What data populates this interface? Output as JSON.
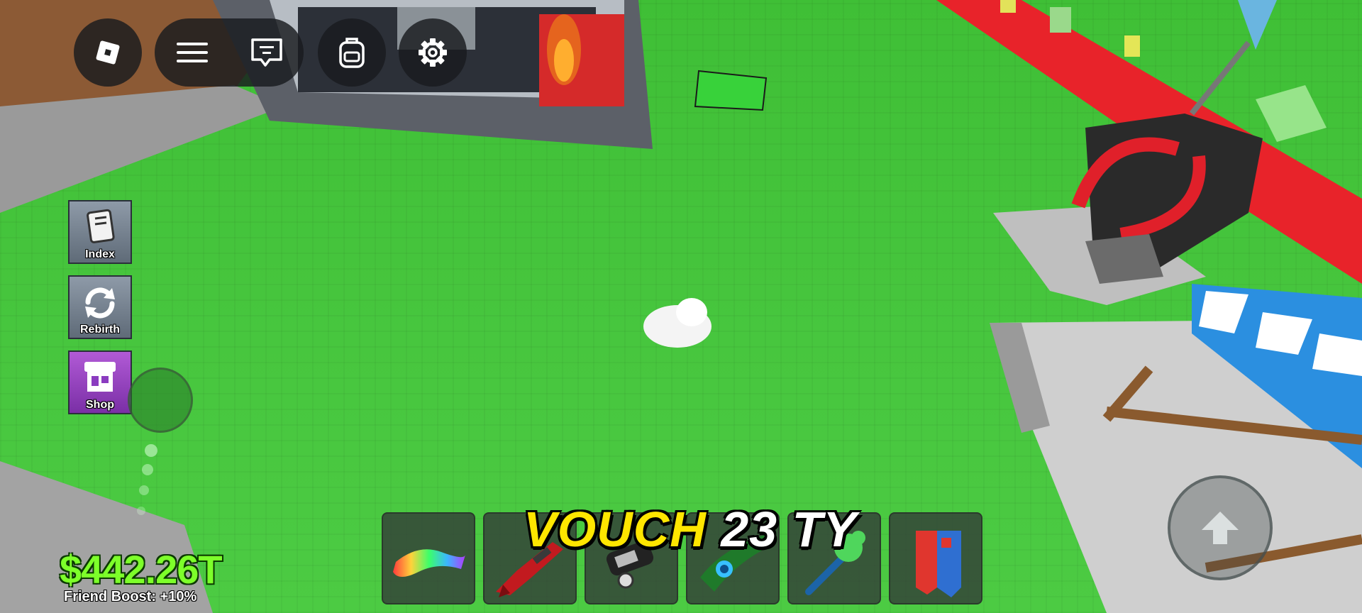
{
  "topbar": {
    "roblox_icon": "roblox-logo-icon",
    "menu_icon": "hamburger-menu-icon",
    "chat_icon": "chat-icon",
    "backpack_icon": "backpack-icon",
    "settings_icon": "gear-icon"
  },
  "side_menu": {
    "items": [
      {
        "label": "Index",
        "icon": "book-icon"
      },
      {
        "label": "Rebirth",
        "icon": "refresh-icon"
      },
      {
        "label": "Shop",
        "icon": "store-icon"
      }
    ]
  },
  "hud": {
    "money": "$442.26T",
    "friend_boost": "Friend Boost: +10%"
  },
  "overlay": {
    "word1": "VOUCH",
    "word2": "23",
    "word3": "TY"
  },
  "hotbar": {
    "slots": [
      {
        "item": "rainbow-carpet-icon"
      },
      {
        "item": "red-rifle-icon"
      },
      {
        "item": "dark-tool-icon"
      },
      {
        "item": "green-blaster-icon"
      },
      {
        "item": "green-gummy-bat-icon"
      },
      {
        "item": "blue-red-block-icon"
      }
    ]
  },
  "controls": {
    "jump_icon": "jump-arrow-icon",
    "thumbstick": "thumbstick"
  },
  "colors": {
    "grass": "#45c23c",
    "money": "#7dff2a",
    "overlay_yellow": "#ffe600",
    "carpet_red": "#e8232a"
  }
}
